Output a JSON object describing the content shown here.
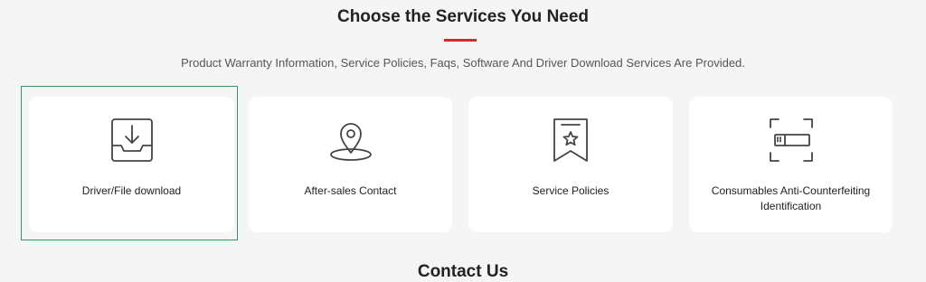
{
  "header": {
    "title": "Choose the Services You Need",
    "subtitle": "Product Warranty Information, Service Policies, Faqs, Software And Driver Download Services Are Provided.",
    "accent_color": "#d7262e"
  },
  "services": [
    {
      "label": "Driver/File download",
      "icon": "download-tray-icon",
      "selected": true
    },
    {
      "label": "After-sales Contact",
      "icon": "location-pin-icon",
      "selected": false
    },
    {
      "label": "Service Policies",
      "icon": "star-ribbon-icon",
      "selected": false
    },
    {
      "label": "Consumables Anti-Counterfeiting Identification",
      "icon": "scan-frame-icon",
      "selected": false
    }
  ],
  "selection_color": "#2e9a61",
  "next_section": {
    "title": "Contact Us"
  }
}
